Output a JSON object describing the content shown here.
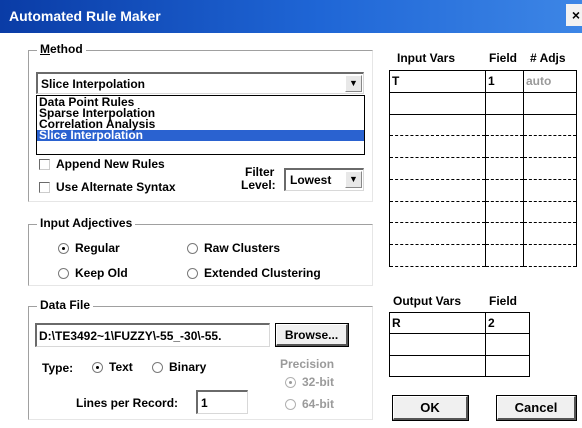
{
  "window": {
    "title": "Automated Rule Maker",
    "close_glyph": "×"
  },
  "method": {
    "group_label": "Method",
    "selected": "Slice Interpolation",
    "options": [
      "Data Point Rules",
      "Sparse Interpolation",
      "Correlation Analysis",
      "Slice Interpolation"
    ],
    "append_label": "Append New Rules",
    "alt_syntax_label": "Use Alternate Syntax",
    "filter_label_1": "Filter",
    "filter_label_2": "Level:",
    "filter_value": "Lowest"
  },
  "input_adjectives": {
    "group_label": "Input Adjectives",
    "regular": "Regular",
    "raw_clusters": "Raw Clusters",
    "keep_old": "Keep Old",
    "extended": "Extended Clustering"
  },
  "data_file": {
    "group_label": "Data File",
    "path": "D:\\TE3492~1\\FUZZY\\-55_-30\\-55.",
    "browse_label": "Browse...",
    "type_label": "Type:",
    "text_label": "Text",
    "binary_label": "Binary",
    "precision_label": "Precision",
    "bit32_label": "32-bit",
    "bit64_label": "64-bit",
    "lines_label": "Lines per Record:",
    "lines_value": "1"
  },
  "input_vars": {
    "headers": [
      "Input Vars",
      "Field",
      "# Adjs"
    ],
    "rows": [
      [
        "T",
        "1",
        "auto"
      ]
    ]
  },
  "output_vars": {
    "headers": [
      "Output Vars",
      "Field"
    ],
    "rows": [
      [
        "R",
        "2"
      ]
    ]
  },
  "buttons": {
    "ok": "OK",
    "cancel": "Cancel"
  }
}
